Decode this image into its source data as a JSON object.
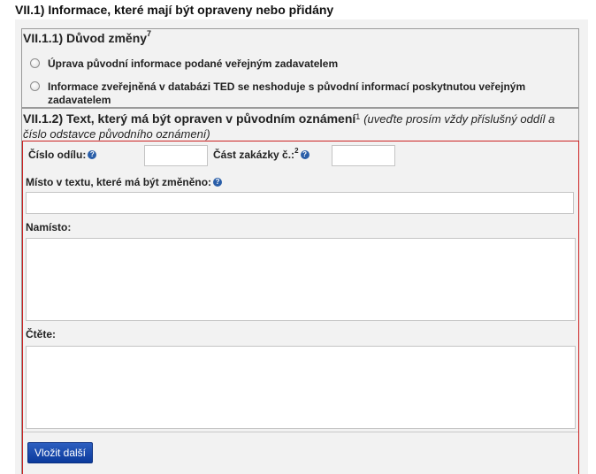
{
  "section": {
    "heading": "VII.1) Informace, které mají být opraveny nebo přidány"
  },
  "reason": {
    "title": "VII.1.1) Důvod změny",
    "title_sup": "7",
    "options": [
      "Úprava původní informace podané veřejným zadavatelem",
      "Informace zveřejněná v databázi TED se neshoduje s původní informací poskytnutou veřejným zadavatelem"
    ]
  },
  "text_section": {
    "title": "VII.1.2) Text, který má být opraven v původním oznámení",
    "title_sup": "1",
    "note": "(uveďte prosím vždy příslušný oddíl a číslo odstavce původního oznámení)"
  },
  "form": {
    "section_number_label": "Číslo odílu:",
    "lot_label": "Část zakázky č.:",
    "lot_sup": "2",
    "place_label": "Místo v textu, které má být změněno:",
    "instead_label": "Namísto:",
    "read_label": "Čtěte:",
    "help_glyph": "?",
    "section_number_value": "",
    "lot_value": "",
    "place_value": "",
    "instead_value": "",
    "read_value": ""
  },
  "actions": {
    "insert_more": "Vložit další"
  },
  "colors": {
    "accent_border": "#cc2222",
    "button": "#1a4aa8",
    "help_icon": "#2a5ea8"
  }
}
